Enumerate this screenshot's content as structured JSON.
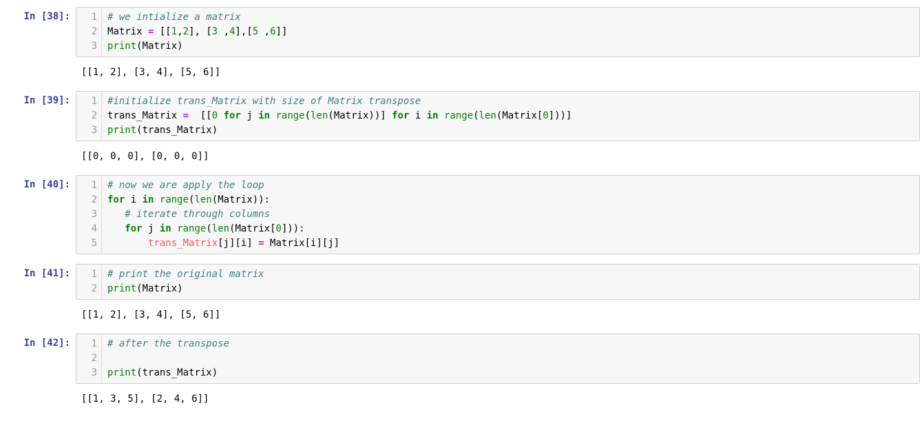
{
  "cells": [
    {
      "prompt": "In [38]:",
      "lines": [
        "1",
        "2",
        "3"
      ],
      "code_html": "<span class=\"cm-comment\"># we intialize a matrix</span>\nMatrix <span class=\"cm-operator\">=</span> [[<span class=\"cm-number\">1</span>,<span class=\"cm-number\">2</span>], [<span class=\"cm-number\">3</span> ,<span class=\"cm-number\">4</span>],[<span class=\"cm-number\">5</span> ,<span class=\"cm-number\">6</span>]]\n<span class=\"cm-builtin\">print</span>(Matrix)",
      "code_plain": "# we intialize a matrix\nMatrix = [[1,2], [3 ,4],[5 ,6]]\nprint(Matrix)",
      "output": "[[1, 2], [3, 4], [5, 6]]"
    },
    {
      "prompt": "In [39]:",
      "lines": [
        "1",
        "2",
        "3"
      ],
      "code_html": "<span class=\"cm-comment\">#initialize trans_Matrix with size of Matrix transpose</span>\ntrans_Matrix <span class=\"cm-operator\">=</span>  [[<span class=\"cm-number\">0</span> <span class=\"cm-keyword\">for</span> j <span class=\"cm-keyword\">in</span> <span class=\"cm-builtin\">range</span>(<span class=\"cm-builtin\">len</span>(Matrix))] <span class=\"cm-keyword\">for</span> i <span class=\"cm-keyword\">in</span> <span class=\"cm-builtin\">range</span>(<span class=\"cm-builtin\">len</span>(Matrix[<span class=\"cm-number\">0</span>]))]\n<span class=\"cm-builtin\">print</span>(trans_Matrix)",
      "code_plain": "#initialize trans_Matrix with size of Matrix transpose\ntrans_Matrix =  [[0 for j in range(len(Matrix))] for i in range(len(Matrix[0]))]\nprint(trans_Matrix)",
      "output": "[[0, 0, 0], [0, 0, 0]]"
    },
    {
      "prompt": "In [40]:",
      "lines": [
        "1",
        "2",
        "3",
        "4",
        "5"
      ],
      "code_html": "<span class=\"cm-comment\"># now we are apply the loop</span>\n<span class=\"cm-keyword\">for</span> i <span class=\"cm-keyword\">in</span> <span class=\"cm-builtin\">range</span>(<span class=\"cm-builtin\">len</span>(Matrix)):\n   <span class=\"cm-comment\"># iterate through columns</span>\n   <span class=\"cm-keyword\">for</span> j <span class=\"cm-keyword\">in</span> <span class=\"cm-builtin\">range</span>(<span class=\"cm-builtin\">len</span>(Matrix[<span class=\"cm-number\">0</span>])):\n       <span class=\"cm-err\">trans_Matrix</span>[j][i] <span class=\"cm-operator\">=</span> Matrix[i][j]",
      "code_plain": "# now we are apply the loop\nfor i in range(len(Matrix)):\n   # iterate through columns\n   for j in range(len(Matrix[0])):\n       trans_Matrix[j][i] = Matrix[i][j]",
      "output": null
    },
    {
      "prompt": "In [41]:",
      "lines": [
        "1",
        "2"
      ],
      "code_html": "<span class=\"cm-comment\"># print the original matrix</span>\n<span class=\"cm-builtin\">print</span>(Matrix)",
      "code_plain": "# print the original matrix\nprint(Matrix)",
      "output": "[[1, 2], [3, 4], [5, 6]]"
    },
    {
      "prompt": "In [42]:",
      "lines": [
        "1",
        "2",
        "3"
      ],
      "code_html": "<span class=\"cm-comment\"># after the transpose</span>\n\n<span class=\"cm-builtin\">print</span>(trans_Matrix)",
      "code_plain": "# after the transpose\n\nprint(trans_Matrix)",
      "output": "[[1, 3, 5], [2, 4, 6]]"
    }
  ]
}
